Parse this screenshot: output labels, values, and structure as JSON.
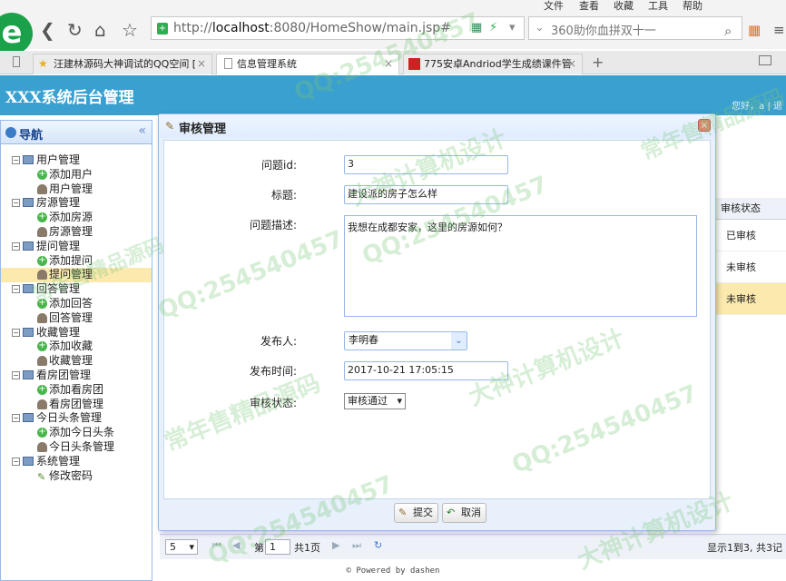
{
  "browser": {
    "menu": [
      "文件",
      "查看",
      "收藏",
      "工具",
      "帮助"
    ],
    "url_host": "localhost",
    "url_rest": ":8080/HomeShow/main.jsp#",
    "url_prefix": "http://",
    "search_text": "360助你血拼双十一",
    "tabs": [
      {
        "label": "汪建林源码大神调试的QQ空间 [",
        "active": false
      },
      {
        "label": "信息管理系统",
        "active": true
      },
      {
        "label": "775安卓Andriod学生成绩课件管",
        "active": false
      }
    ]
  },
  "app": {
    "title": "XXX系统后台管理",
    "welcome": "您好，a | 退"
  },
  "nav": {
    "header": "导航",
    "groups": [
      {
        "label": "用户管理",
        "items": [
          {
            "label": "添加用户",
            "icon": "add-icon"
          },
          {
            "label": "用户管理",
            "icon": "user-icon"
          }
        ]
      },
      {
        "label": "房源管理",
        "items": [
          {
            "label": "添加房源",
            "icon": "add-icon"
          },
          {
            "label": "房源管理",
            "icon": "user-icon"
          }
        ]
      },
      {
        "label": "提问管理",
        "items": [
          {
            "label": "添加提问",
            "icon": "add-icon"
          },
          {
            "label": "提问管理",
            "icon": "user-icon",
            "selected": true
          }
        ]
      },
      {
        "label": "回答管理",
        "items": [
          {
            "label": "添加回答",
            "icon": "add-icon"
          },
          {
            "label": "回答管理",
            "icon": "user-icon"
          }
        ]
      },
      {
        "label": "收藏管理",
        "items": [
          {
            "label": "添加收藏",
            "icon": "add-icon"
          },
          {
            "label": "收藏管理",
            "icon": "user-icon"
          }
        ]
      },
      {
        "label": "看房团管理",
        "items": [
          {
            "label": "添加看房团",
            "icon": "add-icon"
          },
          {
            "label": "看房团管理",
            "icon": "user-icon"
          }
        ]
      },
      {
        "label": "今日头条管理",
        "items": [
          {
            "label": "添加今日头条",
            "icon": "add-icon"
          },
          {
            "label": "今日头条管理",
            "icon": "user-icon"
          }
        ]
      },
      {
        "label": "系统管理",
        "items": [
          {
            "label": "修改密码",
            "icon": "edit-icon"
          }
        ]
      }
    ]
  },
  "grid": {
    "column_header": "审核状态",
    "cells": [
      "已审核",
      "未审核",
      "未审核"
    ]
  },
  "pager": {
    "page_size": "5",
    "page_label": "第",
    "page_value": "1",
    "page_total": "共1页",
    "info": "显示1到3, 共3记"
  },
  "dialog": {
    "title": "审核管理",
    "fields": {
      "id_label": "问题id:",
      "id_value": "3",
      "title_label": "标题:",
      "title_value": "建设派的房子怎么样",
      "desc_label": "问题描述:",
      "desc_value": "我想在成都安家，这里的房源如何？",
      "author_label": "发布人:",
      "author_value": "李明春",
      "time_label": "发布时间:",
      "time_value": "2017-10-21 17:05:15",
      "status_label": "审核状态:",
      "status_value": "审核通过"
    },
    "submit_label": "提交",
    "cancel_label": "取消"
  },
  "footer": "© Powered by dashen",
  "watermarks": [
    "QQ:254540457",
    "常年售精品源码",
    "大神计算机设计"
  ]
}
